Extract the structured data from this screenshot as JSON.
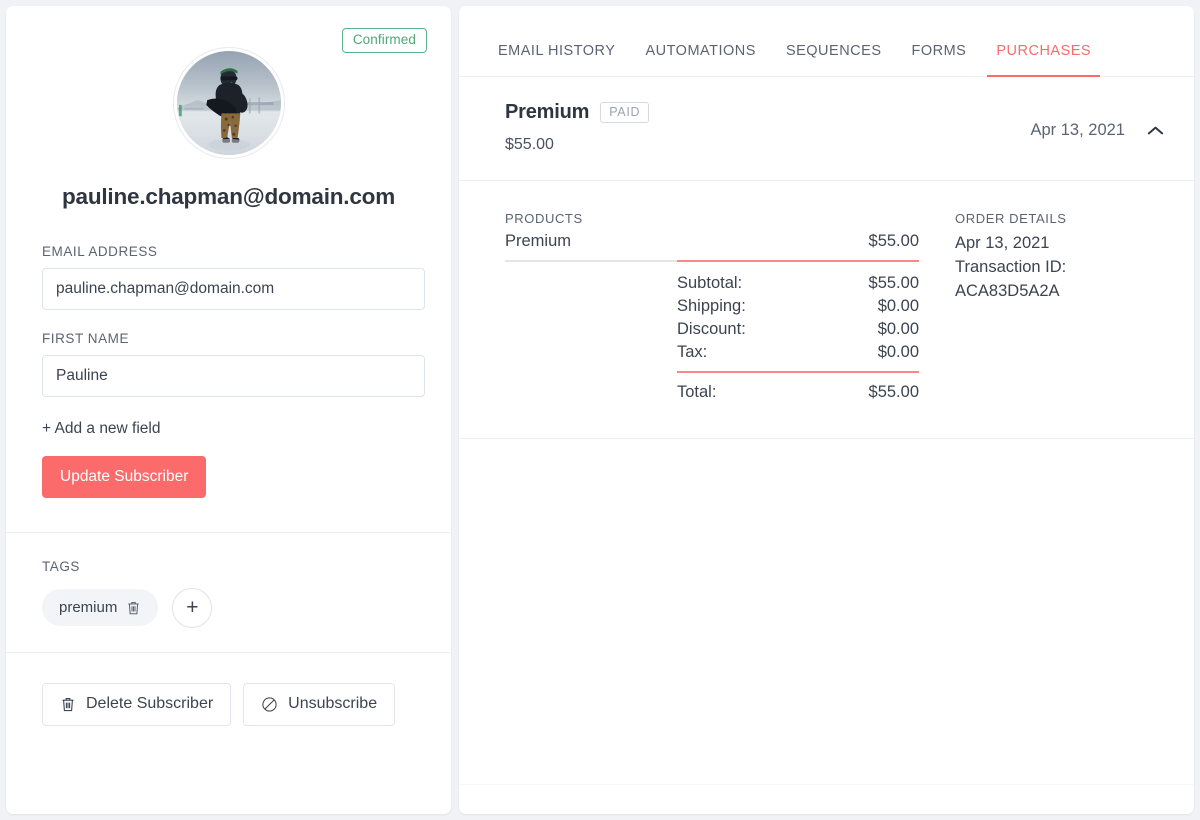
{
  "subscriber": {
    "status_badge": "Confirmed",
    "email_title": "pauline.chapman@domain.com",
    "avatar_alt": "snowboarder-photo",
    "fields": [
      {
        "label": "EMAIL ADDRESS",
        "value": "pauline.chapman@domain.com",
        "placeholder": "Email address",
        "name": "email-field"
      },
      {
        "label": "FIRST NAME",
        "value": "Pauline",
        "placeholder": "First name",
        "name": "first-name-field"
      }
    ],
    "add_field_label": "+ Add a new field",
    "update_button": "Update Subscriber",
    "tags_label": "TAGS",
    "tags": [
      {
        "label": "premium",
        "delete_icon": "trash-icon"
      }
    ],
    "add_tag_label": "+",
    "delete_button": "Delete Subscriber",
    "unsubscribe_button": "Unsubscribe"
  },
  "tabs": [
    {
      "label": "EMAIL HISTORY",
      "active": false,
      "name": "tab-email-history"
    },
    {
      "label": "AUTOMATIONS",
      "active": false,
      "name": "tab-automations"
    },
    {
      "label": "SEQUENCES",
      "active": false,
      "name": "tab-sequences"
    },
    {
      "label": "FORMS",
      "active": false,
      "name": "tab-forms"
    },
    {
      "label": "PURCHASES",
      "active": true,
      "name": "tab-purchases"
    }
  ],
  "purchase": {
    "name": "Premium",
    "status": "PAID",
    "amount": "$55.00",
    "date": "Apr 13, 2021",
    "collapse_icon": "chevron-up-icon",
    "products_label": "PRODUCTS",
    "products": [
      {
        "name": "Premium",
        "price": "$55.00"
      }
    ],
    "totals": [
      {
        "label": "Subtotal:",
        "value": "$55.00"
      },
      {
        "label": "Shipping:",
        "value": "$0.00"
      },
      {
        "label": "Discount:",
        "value": "$0.00"
      },
      {
        "label": "Tax:",
        "value": "$0.00"
      }
    ],
    "total": {
      "label": "Total:",
      "value": "$55.00"
    },
    "order_details_label": "ORDER DETAILS",
    "order_date": "Apr 13, 2021",
    "transaction_line": "Transaction ID: ACA83D5A2A"
  },
  "colors": {
    "accent_red": "#fb6b6b",
    "confirmed_green": "#4da878",
    "page_bg": "#f1f2f6",
    "text_dark": "#2f3640",
    "text_muted": "#5b6472",
    "border": "#e2e6ec"
  }
}
